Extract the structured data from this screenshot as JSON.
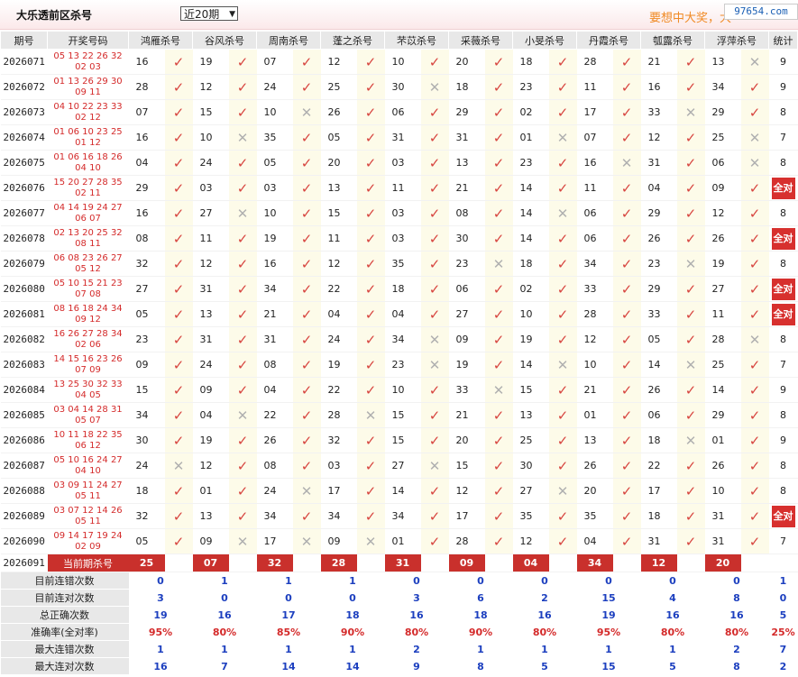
{
  "header": {
    "title": "大乐透前区杀号",
    "period_select": "近20期",
    "slogan": "要想中大奖，大",
    "watermark": "97654.com"
  },
  "columns": [
    "期号",
    "开奖号码",
    "鸿雁杀号",
    "谷风杀号",
    "周南杀号",
    "蓬之杀号",
    "芣苡杀号",
    "采薇杀号",
    "小旻杀号",
    "丹霞杀号",
    "瓠露杀号",
    "浮萍杀号",
    "统计"
  ],
  "rows": [
    {
      "qi": "2026071",
      "kj1": "05 13 22 26 32",
      "kj2": "02 03",
      "kills": [
        "16",
        "19",
        "07",
        "12",
        "10",
        "20",
        "18",
        "28",
        "21",
        "13"
      ],
      "hits": [
        1,
        1,
        1,
        1,
        1,
        1,
        1,
        1,
        1,
        0
      ],
      "stat": "9"
    },
    {
      "qi": "2026072",
      "kj1": "01 13 26 29 30",
      "kj2": "09 11",
      "kills": [
        "28",
        "12",
        "24",
        "25",
        "30",
        "18",
        "23",
        "11",
        "16",
        "34"
      ],
      "hits": [
        1,
        1,
        1,
        1,
        0,
        1,
        1,
        1,
        1,
        1
      ],
      "stat": "9"
    },
    {
      "qi": "2026073",
      "kj1": "04 10 22 23 33",
      "kj2": "02 12",
      "kills": [
        "07",
        "15",
        "10",
        "26",
        "06",
        "29",
        "02",
        "17",
        "33",
        "29"
      ],
      "hits": [
        1,
        1,
        0,
        1,
        1,
        1,
        1,
        1,
        0,
        1
      ],
      "stat": "8"
    },
    {
      "qi": "2026074",
      "kj1": "01 06 10 23 25",
      "kj2": "01 12",
      "kills": [
        "16",
        "10",
        "35",
        "05",
        "31",
        "31",
        "01",
        "07",
        "12",
        "25"
      ],
      "hits": [
        1,
        0,
        1,
        1,
        1,
        1,
        0,
        1,
        1,
        0
      ],
      "stat": "7"
    },
    {
      "qi": "2026075",
      "kj1": "01 06 16 18 26",
      "kj2": "04 10",
      "kills": [
        "04",
        "24",
        "05",
        "20",
        "03",
        "13",
        "23",
        "16",
        "31",
        "06"
      ],
      "hits": [
        1,
        1,
        1,
        1,
        1,
        1,
        1,
        0,
        1,
        0
      ],
      "stat": "8"
    },
    {
      "qi": "2026076",
      "kj1": "15 20 27 28 35",
      "kj2": "02 11",
      "kills": [
        "29",
        "03",
        "03",
        "13",
        "11",
        "21",
        "14",
        "11",
        "04",
        "09"
      ],
      "hits": [
        1,
        1,
        1,
        1,
        1,
        1,
        1,
        1,
        1,
        1
      ],
      "stat": "全对"
    },
    {
      "qi": "2026077",
      "kj1": "04 14 19 24 27",
      "kj2": "06 07",
      "kills": [
        "16",
        "27",
        "10",
        "15",
        "03",
        "08",
        "14",
        "06",
        "29",
        "12"
      ],
      "hits": [
        1,
        0,
        1,
        1,
        1,
        1,
        0,
        1,
        1,
        1
      ],
      "stat": "8"
    },
    {
      "qi": "2026078",
      "kj1": "02 13 20 25 32",
      "kj2": "08 11",
      "kills": [
        "08",
        "11",
        "19",
        "11",
        "03",
        "30",
        "14",
        "06",
        "26",
        "26"
      ],
      "hits": [
        1,
        1,
        1,
        1,
        1,
        1,
        1,
        1,
        1,
        1
      ],
      "stat": "全对"
    },
    {
      "qi": "2026079",
      "kj1": "06 08 23 26 27",
      "kj2": "05 12",
      "kills": [
        "32",
        "12",
        "16",
        "12",
        "35",
        "23",
        "18",
        "34",
        "23",
        "19"
      ],
      "hits": [
        1,
        1,
        1,
        1,
        1,
        0,
        1,
        1,
        0,
        1
      ],
      "stat": "8"
    },
    {
      "qi": "2026080",
      "kj1": "05 10 15 21 23",
      "kj2": "07 08",
      "kills": [
        "27",
        "31",
        "34",
        "22",
        "18",
        "06",
        "02",
        "33",
        "29",
        "27"
      ],
      "hits": [
        1,
        1,
        1,
        1,
        1,
        1,
        1,
        1,
        1,
        1
      ],
      "stat": "全对"
    },
    {
      "qi": "2026081",
      "kj1": "08 16 18 24 34",
      "kj2": "09 12",
      "kills": [
        "05",
        "13",
        "21",
        "04",
        "04",
        "27",
        "10",
        "28",
        "33",
        "11"
      ],
      "hits": [
        1,
        1,
        1,
        1,
        1,
        1,
        1,
        1,
        1,
        1
      ],
      "stat": "全对"
    },
    {
      "qi": "2026082",
      "kj1": "16 26 27 28 34",
      "kj2": "02 06",
      "kills": [
        "23",
        "31",
        "31",
        "24",
        "34",
        "09",
        "19",
        "12",
        "05",
        "28"
      ],
      "hits": [
        1,
        1,
        1,
        1,
        0,
        1,
        1,
        1,
        1,
        0
      ],
      "stat": "8"
    },
    {
      "qi": "2026083",
      "kj1": "14 15 16 23 26",
      "kj2": "07 09",
      "kills": [
        "09",
        "24",
        "08",
        "19",
        "23",
        "19",
        "14",
        "10",
        "14",
        "25"
      ],
      "hits": [
        1,
        1,
        1,
        1,
        0,
        1,
        0,
        1,
        0,
        1
      ],
      "stat": "7"
    },
    {
      "qi": "2026084",
      "kj1": "13 25 30 32 33",
      "kj2": "04 05",
      "kills": [
        "15",
        "09",
        "04",
        "22",
        "10",
        "33",
        "15",
        "21",
        "26",
        "14"
      ],
      "hits": [
        1,
        1,
        1,
        1,
        1,
        0,
        1,
        1,
        1,
        1
      ],
      "stat": "9"
    },
    {
      "qi": "2026085",
      "kj1": "03 04 14 28 31",
      "kj2": "05 07",
      "kills": [
        "34",
        "04",
        "22",
        "28",
        "15",
        "21",
        "13",
        "01",
        "06",
        "29"
      ],
      "hits": [
        1,
        0,
        1,
        0,
        1,
        1,
        1,
        1,
        1,
        1
      ],
      "stat": "8"
    },
    {
      "qi": "2026086",
      "kj1": "10 11 18 22 35",
      "kj2": "06 12",
      "kills": [
        "30",
        "19",
        "26",
        "32",
        "15",
        "20",
        "25",
        "13",
        "18",
        "01"
      ],
      "hits": [
        1,
        1,
        1,
        1,
        1,
        1,
        1,
        1,
        0,
        1
      ],
      "stat": "9"
    },
    {
      "qi": "2026087",
      "kj1": "05 10 16 24 27",
      "kj2": "04 10",
      "kills": [
        "24",
        "12",
        "08",
        "03",
        "27",
        "15",
        "30",
        "26",
        "22",
        "26"
      ],
      "hits": [
        0,
        1,
        1,
        1,
        0,
        1,
        1,
        1,
        1,
        1
      ],
      "stat": "8"
    },
    {
      "qi": "2026088",
      "kj1": "03 09 11 24 27",
      "kj2": "05 11",
      "kills": [
        "18",
        "01",
        "24",
        "17",
        "14",
        "12",
        "27",
        "20",
        "17",
        "10"
      ],
      "hits": [
        1,
        1,
        0,
        1,
        1,
        1,
        0,
        1,
        1,
        1
      ],
      "stat": "8"
    },
    {
      "qi": "2026089",
      "kj1": "03 07 12 14 26",
      "kj2": "05 11",
      "kills": [
        "32",
        "13",
        "34",
        "34",
        "34",
        "17",
        "35",
        "35",
        "18",
        "31"
      ],
      "hits": [
        1,
        1,
        1,
        1,
        1,
        1,
        1,
        1,
        1,
        1
      ],
      "stat": "全对"
    },
    {
      "qi": "2026090",
      "kj1": "09 14 17 19 24",
      "kj2": "02 09",
      "kills": [
        "05",
        "09",
        "17",
        "09",
        "01",
        "28",
        "12",
        "04",
        "31",
        "31"
      ],
      "hits": [
        1,
        0,
        0,
        0,
        1,
        1,
        1,
        1,
        1,
        1
      ],
      "stat": "7"
    }
  ],
  "current": {
    "qi": "2026091",
    "label": "当前期杀号",
    "kills": [
      "25",
      "07",
      "32",
      "28",
      "31",
      "09",
      "04",
      "34",
      "12",
      "20"
    ]
  },
  "stats": [
    {
      "label": "目前连错次数",
      "values": [
        "0",
        "1",
        "1",
        "1",
        "0",
        "0",
        "0",
        "0",
        "0",
        "0",
        "1"
      ]
    },
    {
      "label": "目前连对次数",
      "values": [
        "3",
        "0",
        "0",
        "0",
        "3",
        "6",
        "2",
        "15",
        "4",
        "8",
        "0"
      ]
    },
    {
      "label": "总正确次数",
      "values": [
        "19",
        "16",
        "17",
        "18",
        "16",
        "18",
        "16",
        "19",
        "16",
        "16",
        "5"
      ]
    },
    {
      "label": "准确率(全对率)",
      "values": [
        "95%",
        "80%",
        "85%",
        "90%",
        "80%",
        "90%",
        "80%",
        "95%",
        "80%",
        "80%",
        "25%"
      ]
    },
    {
      "label": "最大连错次数",
      "values": [
        "1",
        "1",
        "1",
        "1",
        "2",
        "1",
        "1",
        "1",
        "1",
        "2",
        "7"
      ]
    },
    {
      "label": "最大连对次数",
      "values": [
        "16",
        "7",
        "14",
        "14",
        "9",
        "8",
        "5",
        "15",
        "5",
        "8",
        "2"
      ]
    }
  ],
  "icons": {
    "hit": "check-mark-icon",
    "miss": "cross-mark-icon"
  },
  "colors": {
    "hit": "#d7443f",
    "miss": "#b0b0b0",
    "full": "#d7302e",
    "stat_value": "#1c3fbf",
    "stat_pct": "#d42a2a"
  }
}
